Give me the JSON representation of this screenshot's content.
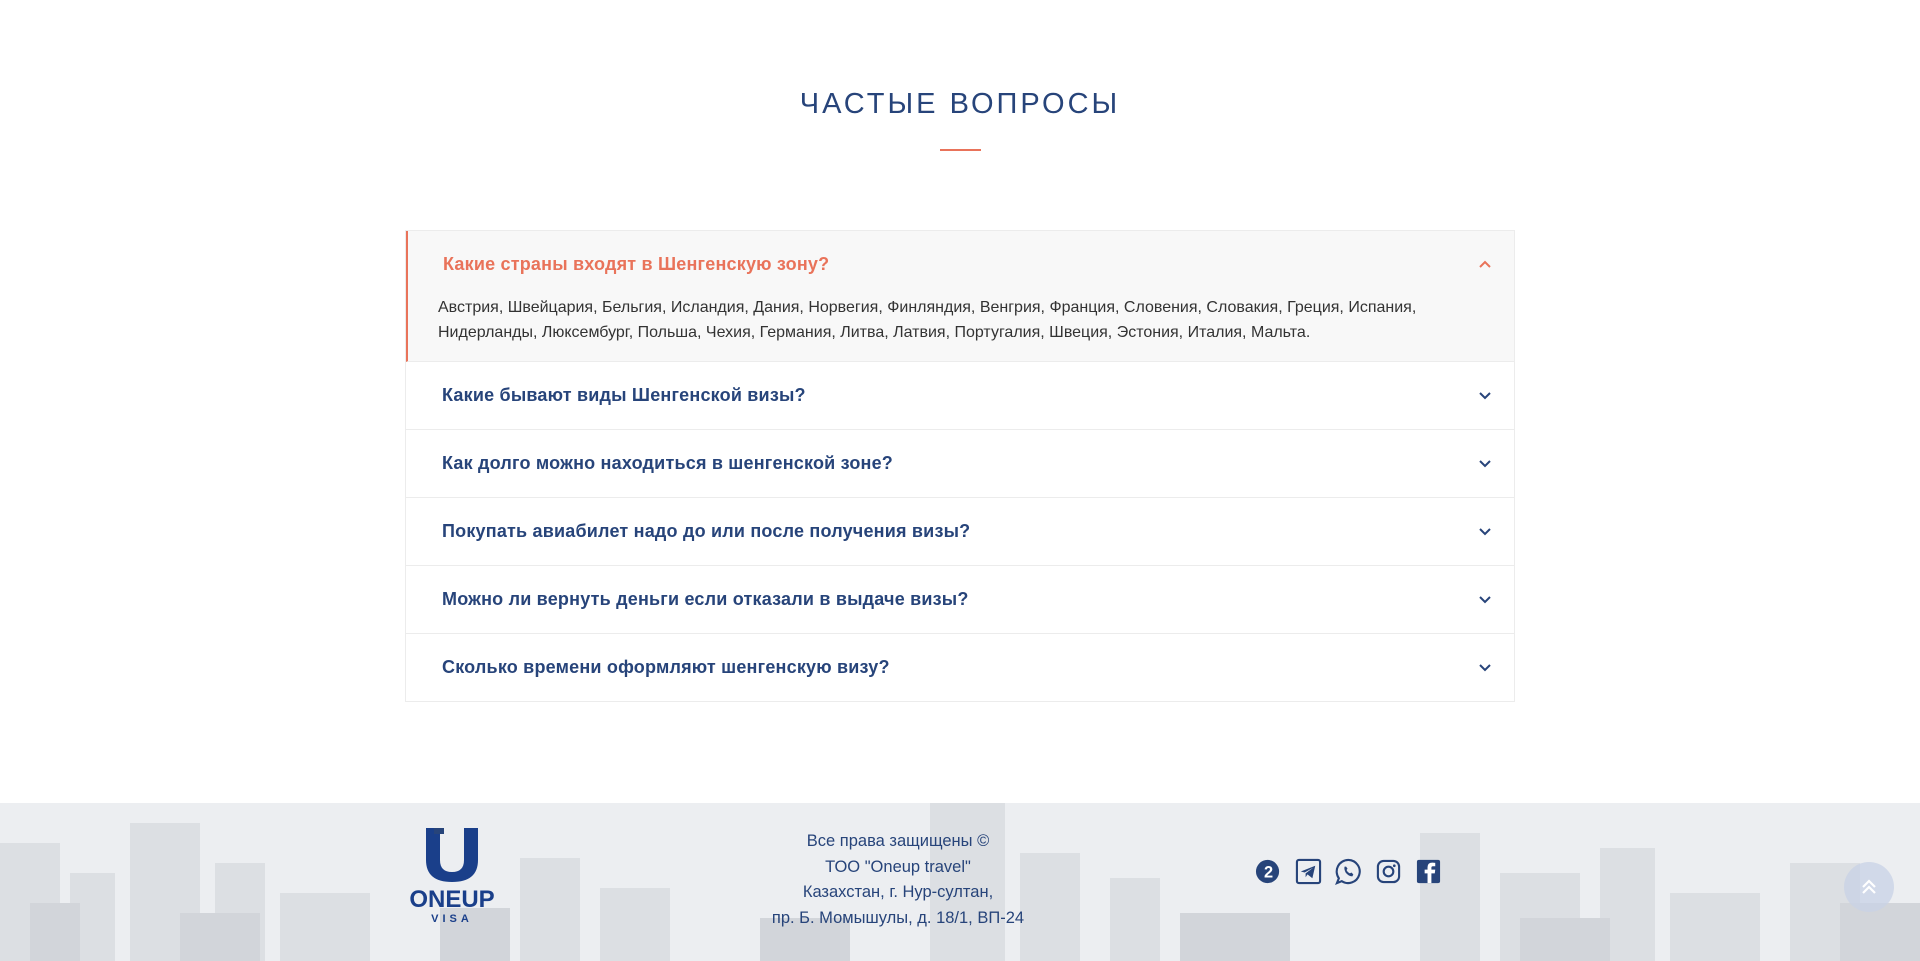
{
  "faq": {
    "title": "ЧАСТЫЕ ВОПРОСЫ",
    "items": [
      {
        "question": "Какие страны входят в Шенгенскую зону?",
        "answer_line1": "Австрия, Швейцария, Бельгия, Исландия, Дания, Норвегия, Финляндия, Венгрия, Франция, Словения, Словакия, Греция, Испания,",
        "answer_line2": "Нидерланды, Люксембург, Польша, Чехия, Германия, Литва, Латвия, Португалия, Швеция, Эстония, Италия, Мальта.",
        "expanded": true
      },
      {
        "question": "Какие бывают виды Шенгенской визы?",
        "expanded": false
      },
      {
        "question": "Как долго можно находиться в шенгенской зоне?",
        "expanded": false
      },
      {
        "question": "Покупать авиабилет надо до или после получения визы?",
        "expanded": false
      },
      {
        "question": "Можно ли вернуть деньги если отказали в выдаче визы?",
        "expanded": false
      },
      {
        "question": "Сколько времени оформляют шенгенскую визу?",
        "expanded": false
      }
    ]
  },
  "footer": {
    "logo": {
      "name": "ONEUP",
      "sub": "VISA"
    },
    "info": {
      "line1": "Все права защищены ©",
      "line2": "ТОО \"Oneup travel\"",
      "line3": "Казахстан, г. Нур-султан,",
      "line4": "пр. Б. Момышулы, д. 18/1, ВП-24"
    },
    "socials": [
      "2gis-icon",
      "telegram-icon",
      "whatsapp-icon",
      "instagram-icon",
      "facebook-icon"
    ]
  },
  "colors": {
    "primary": "#27447a",
    "accent": "#e9735a",
    "logo": "#1a3f8a"
  }
}
